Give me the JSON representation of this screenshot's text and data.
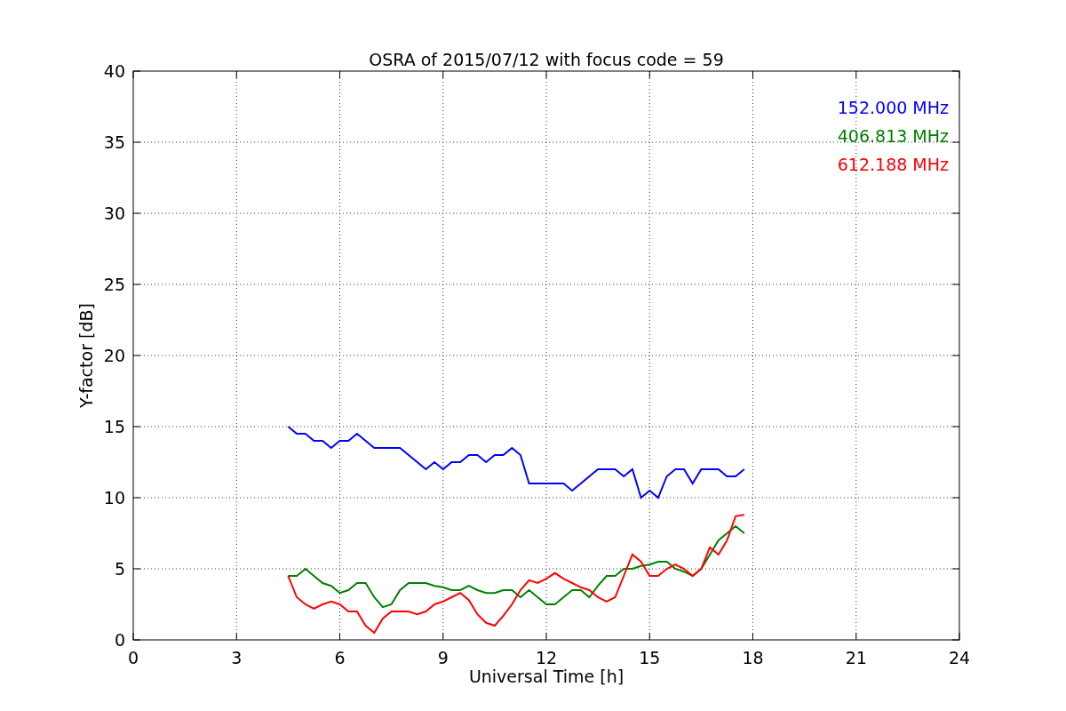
{
  "chart_data": {
    "type": "line",
    "title": "OSRA of 2015/07/12 with focus code = 59",
    "xlabel": "Universal Time [h]",
    "ylabel": "Y-factor [dB]",
    "x": [
      4.5,
      4.75,
      5,
      5.25,
      5.5,
      5.75,
      6,
      6.25,
      6.5,
      6.75,
      7,
      7.25,
      7.5,
      7.75,
      8,
      8.25,
      8.5,
      8.75,
      9,
      9.25,
      9.5,
      9.75,
      10,
      10.25,
      10.5,
      10.75,
      11,
      11.25,
      11.5,
      11.75,
      12,
      12.25,
      12.5,
      12.75,
      13,
      13.25,
      13.5,
      13.75,
      14,
      14.25,
      14.5,
      14.75,
      15,
      15.25,
      15.5,
      15.75,
      16,
      16.25,
      16.5,
      16.75,
      17,
      17.25,
      17.5,
      17.75
    ],
    "series": [
      {
        "name": "152.000 MHz",
        "color": "#0000ff",
        "values": [
          15,
          14.5,
          14.5,
          14,
          14,
          13.5,
          14,
          14,
          14.5,
          14,
          13.5,
          13.5,
          13.5,
          13.5,
          13,
          12.5,
          12,
          12.5,
          12,
          12.5,
          12.5,
          13,
          13,
          12.5,
          13,
          13,
          13.5,
          13,
          11,
          11,
          11,
          11,
          11,
          10.5,
          11,
          11.5,
          12,
          12,
          12,
          11.5,
          12,
          10,
          10.5,
          10,
          11.5,
          12,
          12,
          11,
          12,
          12,
          12,
          11.5,
          11.5,
          12
        ]
      },
      {
        "name": "406.813 MHz",
        "color": "#008000",
        "values": [
          4.5,
          4.5,
          5,
          4.5,
          4,
          3.8,
          3.3,
          3.5,
          4,
          4,
          3,
          2.3,
          2.5,
          3.5,
          4,
          4,
          4,
          3.8,
          3.7,
          3.5,
          3.5,
          3.8,
          3.5,
          3.3,
          3.3,
          3.5,
          3.5,
          3,
          3.5,
          3,
          2.5,
          2.5,
          3,
          3.5,
          3.5,
          3,
          3.8,
          4.5,
          4.5,
          5,
          5,
          5.2,
          5.3,
          5.5,
          5.5,
          5,
          4.8,
          4.5,
          5,
          6,
          7,
          7.5,
          8,
          7.5
        ]
      },
      {
        "name": "612.188 MHz",
        "color": "#ff0000",
        "values": [
          4.5,
          3,
          2.5,
          2.2,
          2.5,
          2.7,
          2.5,
          2,
          2,
          1,
          0.5,
          1.5,
          2,
          2,
          2,
          1.8,
          2,
          2.5,
          2.7,
          3,
          3.3,
          2.8,
          1.8,
          1.2,
          1,
          1.7,
          2.5,
          3.5,
          4.2,
          4,
          4.3,
          4.7,
          4.3,
          4,
          3.7,
          3.5,
          3,
          2.7,
          3,
          4.5,
          6,
          5.5,
          4.5,
          4.5,
          5,
          5.3,
          5,
          4.5,
          5,
          6.5,
          6,
          7,
          8.7,
          8.8
        ]
      }
    ],
    "grid": true,
    "xlim": [
      0,
      24
    ],
    "ylim": [
      0,
      40
    ],
    "xticks": [
      0,
      3,
      6,
      9,
      12,
      15,
      18,
      21,
      24
    ],
    "yticks": [
      0,
      5,
      10,
      15,
      20,
      25,
      30,
      35,
      40
    ]
  }
}
